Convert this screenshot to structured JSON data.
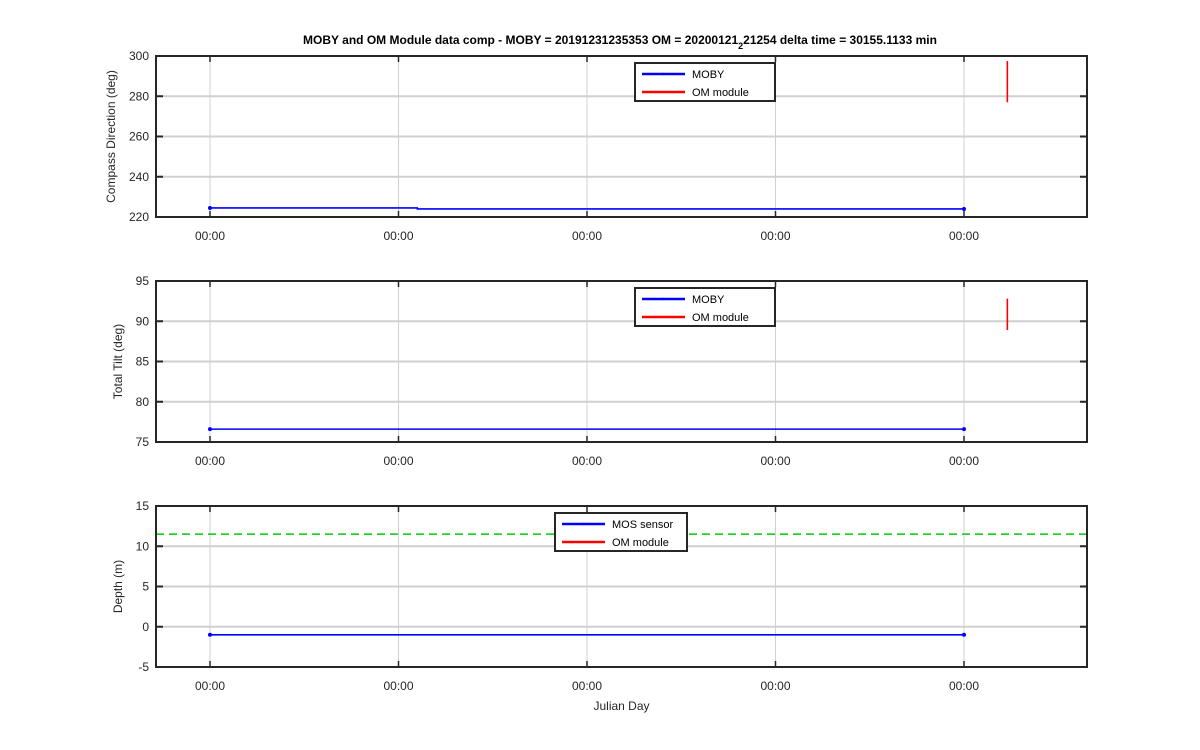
{
  "title": {
    "prefix": "MOBY and OM Module data comp - MOBY = 20191231235353 OM = 20200121",
    "subscript": "2",
    "suffix": "21254 delta time = 30155.1133 min"
  },
  "colors": {
    "moby": "#0000ff",
    "om": "#ff0000",
    "threshold": "#00cc00",
    "grid": "#d0d0d0",
    "axis": "#262626"
  },
  "chart_data": [
    {
      "type": "line",
      "ylabel": "Compass Direction (deg)",
      "xlabel": "",
      "ylim": [
        220,
        300
      ],
      "yticks": [
        220,
        240,
        260,
        280,
        300
      ],
      "xtick_labels": [
        "00:00",
        "00:00",
        "00:00",
        "00:00",
        "00:00"
      ],
      "grid": true,
      "legend_position": "top-center",
      "series": [
        {
          "name": "MOBY",
          "color": "#0000ff",
          "x": [
            0.0,
            1.1,
            1.1,
            4.0
          ],
          "y": [
            224.5,
            224.5,
            224.0,
            224.0
          ]
        },
        {
          "name": "OM module",
          "color": "#ff0000",
          "x": [
            4.23,
            4.23
          ],
          "y": [
            277.0,
            297.5
          ]
        }
      ]
    },
    {
      "type": "line",
      "ylabel": "Total Tilt (deg)",
      "xlabel": "",
      "ylim": [
        75,
        95
      ],
      "yticks": [
        75,
        80,
        85,
        90,
        95
      ],
      "xtick_labels": [
        "00:00",
        "00:00",
        "00:00",
        "00:00",
        "00:00"
      ],
      "grid": true,
      "legend_position": "top-center",
      "series": [
        {
          "name": "MOBY",
          "color": "#0000ff",
          "x": [
            0.0,
            4.0
          ],
          "y": [
            76.6,
            76.6
          ]
        },
        {
          "name": "OM module",
          "color": "#ff0000",
          "x": [
            4.23,
            4.23
          ],
          "y": [
            88.9,
            92.8
          ]
        }
      ]
    },
    {
      "type": "line",
      "ylabel": "Depth (m)",
      "xlabel": "Julian Day",
      "ylim": [
        -5,
        15
      ],
      "yticks": [
        -5,
        0,
        5,
        10,
        15
      ],
      "xtick_labels": [
        "00:00",
        "00:00",
        "00:00",
        "00:00",
        "00:00"
      ],
      "grid": true,
      "legend_position": "top-center",
      "threshold": 11.5,
      "series": [
        {
          "name": "MOS sensor",
          "color": "#0000ff",
          "x": [
            0.0,
            4.0
          ],
          "y": [
            -1.0,
            -1.0
          ]
        },
        {
          "name": "OM module",
          "color": "#ff0000",
          "x": [],
          "y": []
        }
      ]
    }
  ]
}
